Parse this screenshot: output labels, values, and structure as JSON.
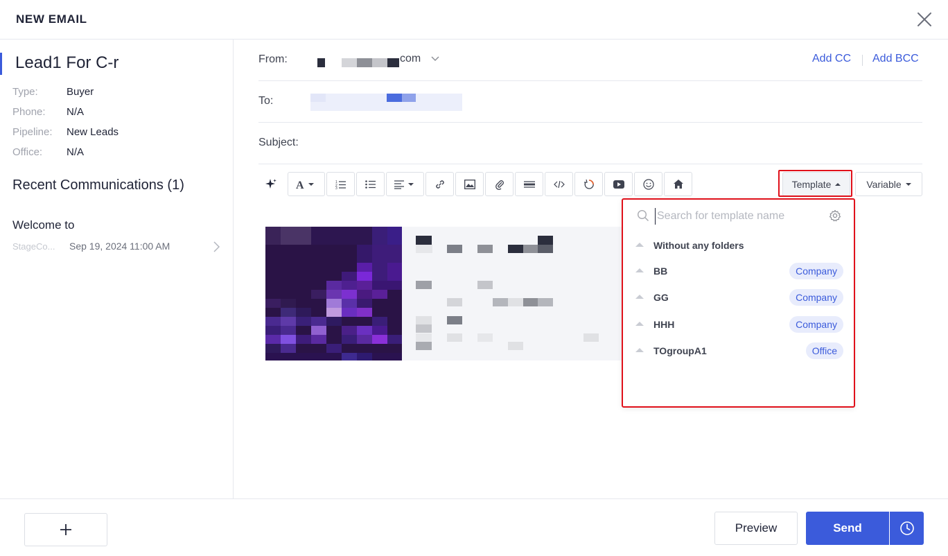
{
  "header": {
    "title": "NEW EMAIL"
  },
  "lead": {
    "name": "Lead1 For C-r",
    "info": [
      {
        "key": "Type:",
        "value": "Buyer"
      },
      {
        "key": "Phone:",
        "value": "N/A"
      },
      {
        "key": "Pipeline:",
        "value": "New Leads"
      },
      {
        "key": "Office:",
        "value": "N/A"
      }
    ]
  },
  "recent": {
    "title": "Recent Communications (1)",
    "items": [
      {
        "title": "Welcome to",
        "source": "StageCo...",
        "date": "Sep 19, 2024 11:00 AM"
      }
    ]
  },
  "compose": {
    "from_label": "From:",
    "from_suffix": "com",
    "add_cc": "Add CC",
    "add_bcc": "Add BCC",
    "to_label": "To:",
    "subject_label": "Subject:"
  },
  "toolbar": {
    "template_label": "Template",
    "variable_label": "Variable",
    "buttons": [
      "sparkle-icon",
      "font-icon",
      "ordered-list-icon",
      "bullet-list-icon",
      "align-icon",
      "link-icon",
      "image-icon",
      "attachment-icon",
      "horizontal-rule-icon",
      "code-icon",
      "loading-icon",
      "video-icon",
      "emoji-icon",
      "home-icon"
    ]
  },
  "template_dropdown": {
    "search_placeholder": "Search for template name",
    "folders": [
      {
        "name": "Without any folders",
        "badge": ""
      },
      {
        "name": "BB",
        "badge": "Company"
      },
      {
        "name": "GG",
        "badge": "Company"
      },
      {
        "name": "HHH",
        "badge": "Company"
      },
      {
        "name": "TOgroupA1",
        "badge": "Office"
      }
    ]
  },
  "footer": {
    "preview_label": "Preview",
    "send_label": "Send"
  },
  "colors": {
    "accent": "#3b5bdb",
    "highlight_outline": "#e0101a",
    "badge_bg": "#e8ecfc"
  }
}
